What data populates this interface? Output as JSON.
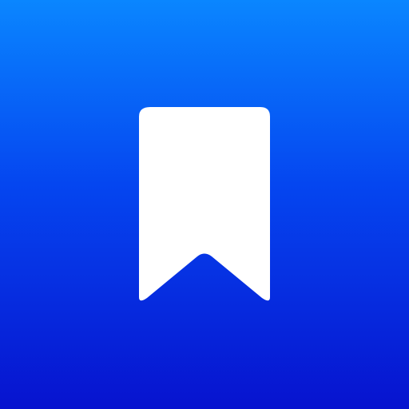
{
  "icon": {
    "name": "bookmark-icon",
    "glyph_color": "#FFFFFF",
    "background_gradient": {
      "top": "#0A86FF",
      "middle": "#0546F0",
      "bottom": "#0713CF"
    }
  }
}
